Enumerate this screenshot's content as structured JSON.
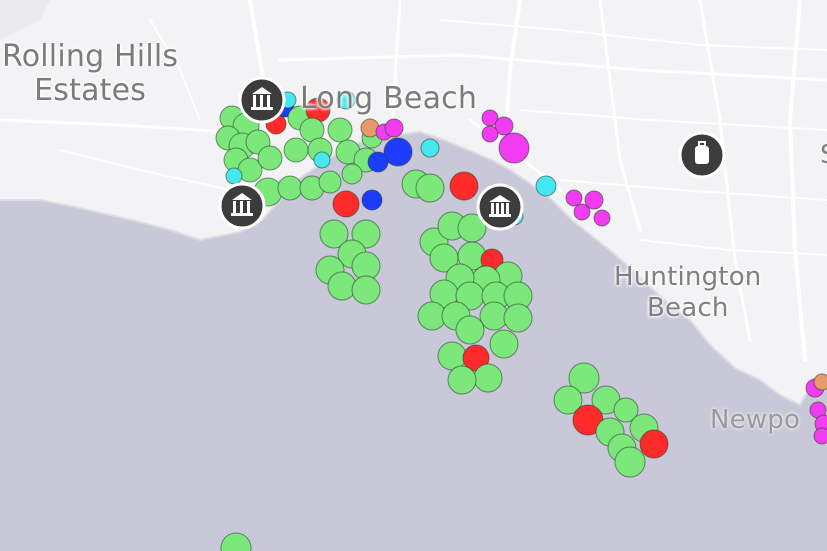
{
  "map": {
    "colors": {
      "water": "#c9c8d8",
      "land": "#f3f3f5",
      "road": "#ffffff",
      "label": "#7b7b7b",
      "facility_icon_bg": "#3c3c3c",
      "status_green": "#7ce87c",
      "status_red": "#ff2a2a",
      "status_blue": "#1e3cff",
      "status_cyan": "#45e8f0",
      "status_magenta": "#f23cf2",
      "status_orange": "#e89a6a"
    },
    "place_labels": {
      "rolling_hills_estates_line1": "Rolling Hills",
      "rolling_hills_estates_line2": "Estates",
      "long_beach": "Long Beach",
      "huntington_beach_line1": "Huntington",
      "huntington_beach_line2": "Beach",
      "newport": "Newpo",
      "edge_fragment": "S"
    },
    "facility_icons": [
      "port-icon",
      "port-icon",
      "building-icon",
      "luggage-icon"
    ],
    "marker_statuses": [
      "green",
      "red",
      "blue",
      "cyan",
      "magenta",
      "orange"
    ]
  }
}
